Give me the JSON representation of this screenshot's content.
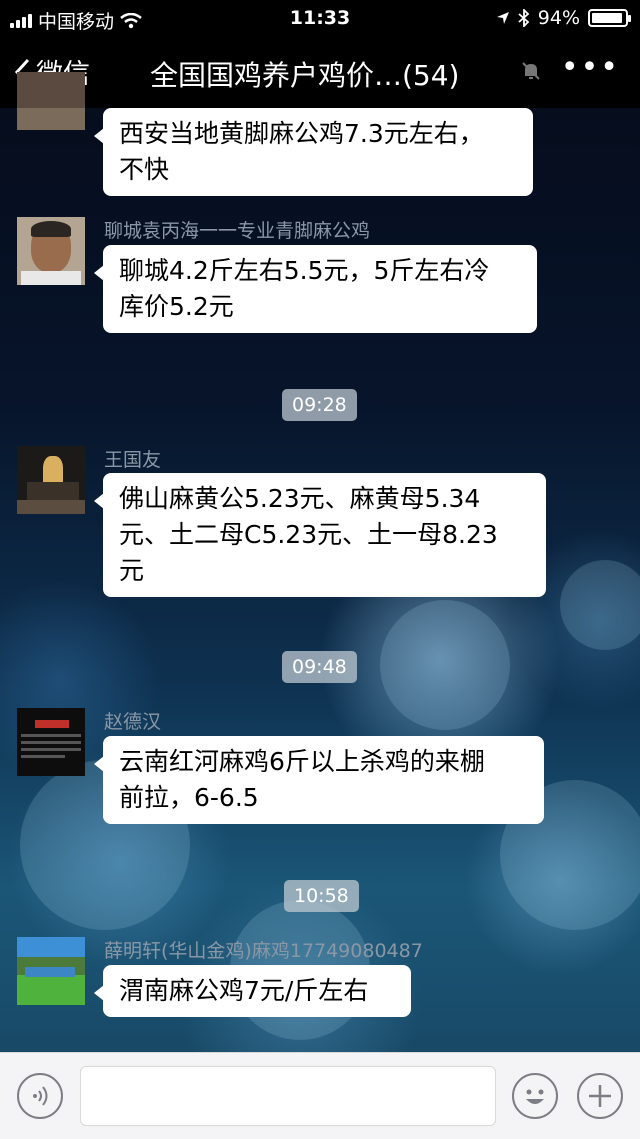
{
  "status_bar": {
    "carrier": "中国移动",
    "time": "11:33",
    "battery": "94%",
    "battery_level": 0.94
  },
  "nav": {
    "back_label": "微信",
    "title": "全国国鸡养户鸡价…(54)",
    "more_label": "•••"
  },
  "messages": [
    {
      "nickname": "",
      "text_lines": [
        "西安当地黄脚麻公鸡7.3元左右，",
        "不快"
      ]
    },
    {
      "nickname": "聊城袁丙海一一专业青脚麻公鸡",
      "text_lines": [
        "聊城4.2斤左右5.5元，5斤左右冷",
        "库价5.2元"
      ]
    },
    {
      "timestamp": "09:28"
    },
    {
      "nickname": "王国友",
      "text_lines": [
        "佛山麻黄公5.23元、麻黄母5.34",
        "元、土二母C5.23元、土一母8.23",
        "元"
      ]
    },
    {
      "timestamp": "09:48"
    },
    {
      "nickname": "赵德汉",
      "text_lines": [
        "云南红河麻鸡6斤以上杀鸡的来棚",
        "前拉，6-6.5"
      ]
    },
    {
      "timestamp": "10:58"
    },
    {
      "nickname": "薛明轩(华山金鸡)麻鸡17749080487",
      "text_lines": [
        "渭南麻公鸡7元/斤左右"
      ]
    }
  ],
  "input_bar": {
    "voice_icon": "voice-icon",
    "emoji_icon": "emoji-icon",
    "plus_icon": "plus-icon"
  }
}
